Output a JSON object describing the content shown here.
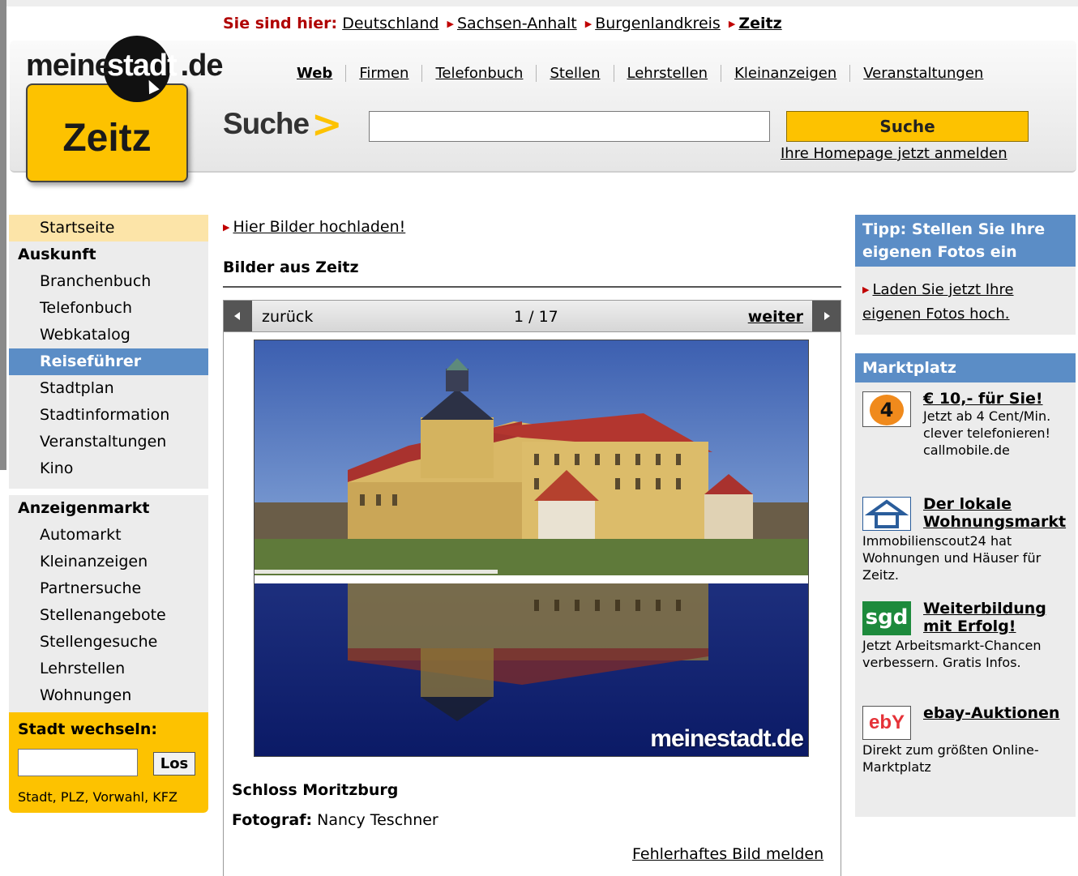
{
  "breadcrumb": {
    "label": "Sie sind hier:",
    "items": [
      "Deutschland",
      "Sachsen-Anhalt",
      "Burgenlandkreis"
    ],
    "current": "Zeitz"
  },
  "logo": {
    "text_left": "meine",
    "text_circle": "stadt",
    "text_right": ".de",
    "city": "Zeitz"
  },
  "top_nav": [
    "Web",
    "Firmen",
    "Telefonbuch",
    "Stellen",
    "Lehrstellen",
    "Kleinanzeigen",
    "Veranstaltungen"
  ],
  "search": {
    "label": "Suche",
    "chevron": ">",
    "value": "",
    "button": "Suche",
    "homepage_link": "Ihre Homepage jetzt anmelden"
  },
  "left_nav": {
    "home": "Startseite",
    "auskunft": {
      "heading": "Auskunft",
      "items": [
        "Branchenbuch",
        "Telefonbuch",
        "Webkatalog",
        "Reiseführer",
        "Stadtplan",
        "Stadtinformation",
        "Veranstaltungen",
        "Kino"
      ],
      "active": "Reiseführer"
    },
    "anzeigen": {
      "heading": "Anzeigenmarkt",
      "items": [
        "Automarkt",
        "Kleinanzeigen",
        "Partnersuche",
        "Stellenangebote",
        "Stellengesuche",
        "Lehrstellen",
        "Wohnungen"
      ]
    },
    "city_switch": {
      "title": "Stadt wechseln:",
      "value": "",
      "button": "Los",
      "hint": "Stadt, PLZ, Vorwahl, KFZ"
    }
  },
  "main": {
    "upload_link": "Hier Bilder hochladen!",
    "section_title": "Bilder aus Zeitz",
    "gallery": {
      "prev": "zurück",
      "counter": "1 / 17",
      "next": "weiter",
      "watermark": "meinestadt.de",
      "photo_title": "Schloss Moritzburg",
      "photographer_label": "Fotograf:",
      "photographer": "Nancy Teschner",
      "report_link": "Fehlerhaftes Bild melden"
    }
  },
  "right": {
    "tip": {
      "title": "Tipp: Stellen Sie Ihre eigenen Fotos ein",
      "link": "Laden Sie jetzt Ihre eigenen Fotos hoch."
    },
    "market": {
      "title": "Marktplatz",
      "ads": [
        {
          "icon": "callmobile-4-icon",
          "title": "€ 10,- für Sie!",
          "text": "Jetzt ab 4 Cent/Min. clever telefonieren! callmobile.de",
          "icon_label": "4"
        },
        {
          "icon": "house-icon",
          "title": "Der lokale Wohnungsmarkt",
          "text": "Immobilienscout24 hat Wohnungen und Häuser für Zeitz."
        },
        {
          "icon": "sgd-logo-icon",
          "title": "Weiterbildung mit Erfolg!",
          "text": "Jetzt Arbeitsmarkt-Chancen verbessern. Gratis Infos.",
          "icon_label": "sgd"
        },
        {
          "icon": "ebay-logo-icon",
          "title": "ebay-Auktionen",
          "text": "Direkt zum größten Online-Marktplatz",
          "icon_label": "ebY"
        }
      ]
    }
  },
  "colors": {
    "accent_yellow": "#fdc200",
    "nav_blue": "#5b8dc6",
    "breadcrumb_red": "#b00000"
  }
}
